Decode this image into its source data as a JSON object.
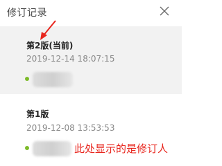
{
  "header": {
    "title": "修订记录",
    "close_icon": "close-icon"
  },
  "versions": [
    {
      "name": "第2版(当前)",
      "date": "2019-12-14 18:07:15",
      "status_color": "#7dbb2a",
      "selected": true
    },
    {
      "name": "第1版",
      "date": "2019-12-08 13:53:53",
      "status_color": "#7dbb2a",
      "selected": false
    }
  ],
  "annotation": {
    "text": "此处显示的是修订人",
    "color": "#e8261e"
  }
}
